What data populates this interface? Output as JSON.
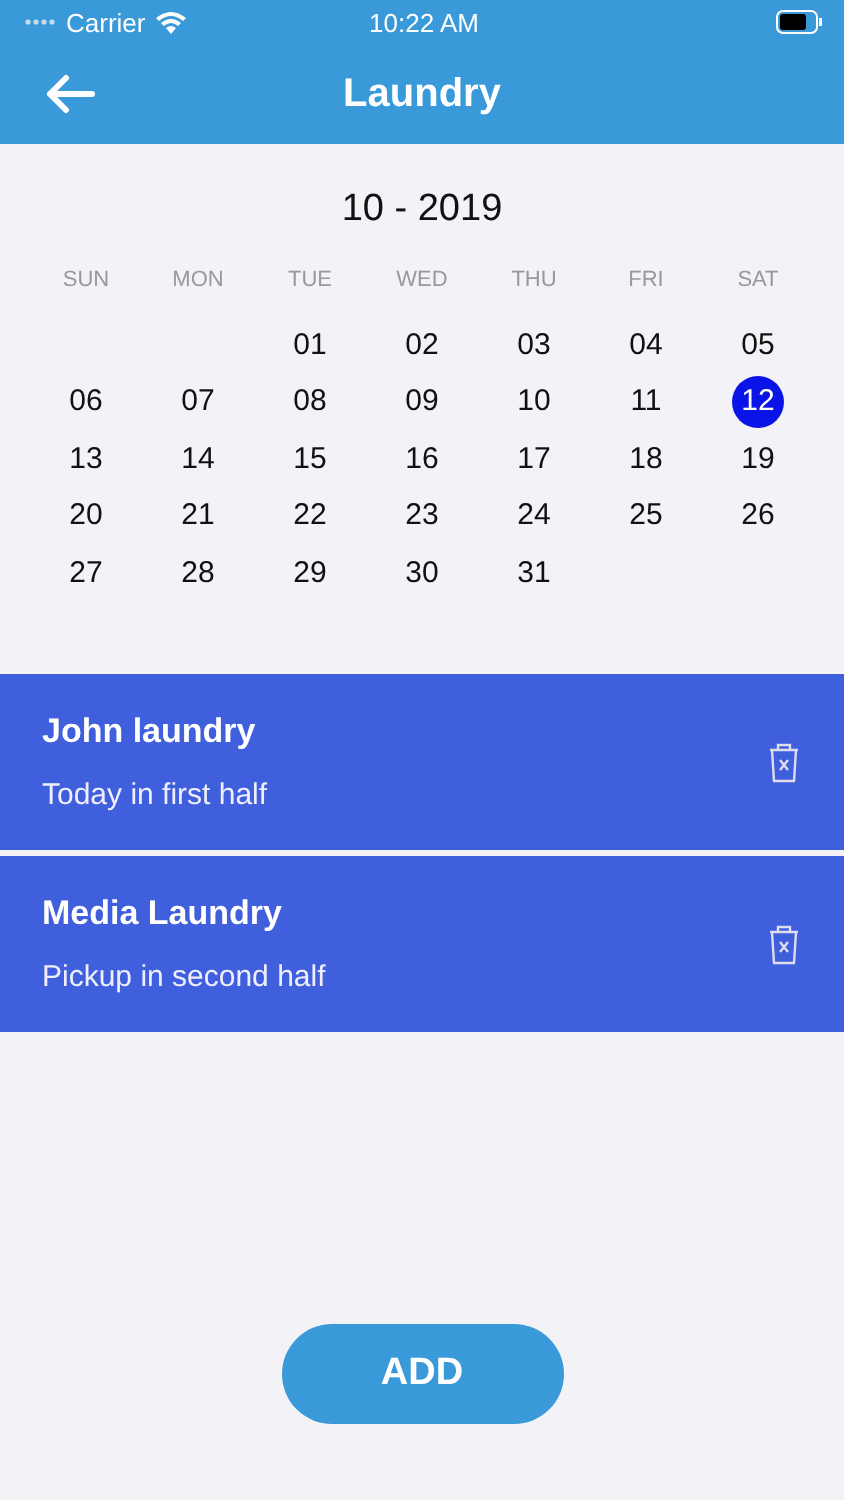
{
  "status_bar": {
    "carrier": "Carrier",
    "time": "10:22 AM"
  },
  "header": {
    "title": "Laundry"
  },
  "calendar": {
    "month": "10 - 2019",
    "weekdays": [
      "SUN",
      "MON",
      "TUE",
      "WED",
      "THU",
      "FRI",
      "SAT"
    ],
    "weeks": [
      [
        {
          "day": "01",
          "selected": false
        },
        {
          "day": "02",
          "selected": false
        },
        {
          "day": "03",
          "selected": false
        },
        {
          "day": "04",
          "selected": false
        },
        {
          "day": "05",
          "selected": false
        }
      ],
      [
        {
          "day": "06",
          "selected": false
        },
        {
          "day": "07",
          "selected": false
        },
        {
          "day": "08",
          "selected": false
        },
        {
          "day": "09",
          "selected": false
        },
        {
          "day": "10",
          "selected": false
        },
        {
          "day": "11",
          "selected": false
        },
        {
          "day": "12",
          "selected": true
        }
      ],
      [
        {
          "day": "13",
          "selected": false
        },
        {
          "day": "14",
          "selected": false
        },
        {
          "day": "15",
          "selected": false
        },
        {
          "day": "16",
          "selected": false
        },
        {
          "day": "17",
          "selected": false
        },
        {
          "day": "18",
          "selected": false
        },
        {
          "day": "19",
          "selected": false
        }
      ],
      [
        {
          "day": "20",
          "selected": false
        },
        {
          "day": "21",
          "selected": false
        },
        {
          "day": "22",
          "selected": false
        },
        {
          "day": "23",
          "selected": false
        },
        {
          "day": "24",
          "selected": false
        },
        {
          "day": "25",
          "selected": false
        },
        {
          "day": "26",
          "selected": false
        }
      ],
      [
        {
          "day": "27",
          "selected": false
        },
        {
          "day": "28",
          "selected": false
        },
        {
          "day": "29",
          "selected": false
        },
        {
          "day": "30",
          "selected": false
        },
        {
          "day": "31",
          "selected": false
        }
      ]
    ]
  },
  "tasks": [
    {
      "title": "John laundry",
      "subtitle": "Today in first half"
    },
    {
      "title": "Media Laundry",
      "subtitle": "Pickup in second half"
    }
  ],
  "add_button": "ADD"
}
